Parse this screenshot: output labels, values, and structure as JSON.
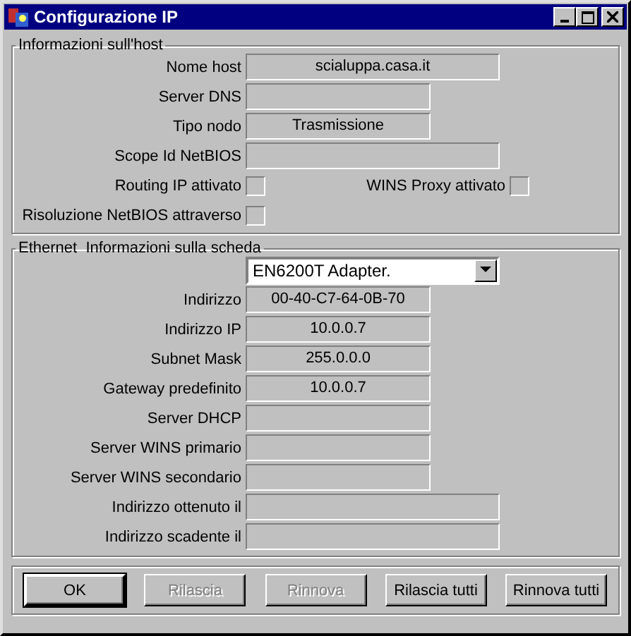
{
  "window": {
    "title": "Configurazione IP"
  },
  "host": {
    "title": "Informazioni sull'host",
    "rows": [
      {
        "kind": "field",
        "label": "Nome host",
        "value": "scialuppa.casa.it"
      },
      {
        "kind": "field",
        "label": "Server DNS",
        "value": ""
      },
      {
        "kind": "field",
        "label": "Tipo nodo",
        "value": "Trasmissione"
      },
      {
        "kind": "field",
        "label": "Scope Id NetBIOS",
        "value": ""
      },
      {
        "kind": "checks",
        "items": [
          {
            "label": "Routing IP attivato",
            "checked": false
          },
          {
            "label": "WINS Proxy attivato",
            "checked": false
          }
        ]
      },
      {
        "kind": "checks",
        "items": [
          {
            "label": "Risoluzione NetBIOS attraverso",
            "checked": false
          }
        ]
      }
    ]
  },
  "adapter": {
    "title": "Ethernet  Informazioni sulla scheda",
    "dropdown": {
      "value": "EN6200T Adapter."
    },
    "rows": [
      {
        "kind": "field",
        "label": "Indirizzo",
        "value": "00-40-C7-64-0B-70"
      },
      {
        "kind": "field",
        "label": "Indirizzo IP",
        "value": "10.0.0.7"
      },
      {
        "kind": "field",
        "label": "Subnet Mask",
        "value": "255.0.0.0"
      },
      {
        "kind": "field",
        "label": "Gateway predefinito",
        "value": "10.0.0.7"
      },
      {
        "kind": "field",
        "label": "Server DHCP",
        "value": ""
      },
      {
        "kind": "field",
        "label": "Server WINS primario",
        "value": ""
      },
      {
        "kind": "field",
        "label": "Server WINS secondario",
        "value": ""
      },
      {
        "kind": "field",
        "label": "Indirizzo ottenuto il",
        "value": ""
      },
      {
        "kind": "field",
        "label": "Indirizzo scadente il",
        "value": ""
      }
    ]
  },
  "buttons": [
    {
      "label": "OK",
      "disabled": false,
      "default": true
    },
    {
      "label": "Rilascia",
      "disabled": true,
      "default": false
    },
    {
      "label": "Rinnova",
      "disabled": true,
      "default": false
    },
    {
      "label": "Rilascia tutti",
      "disabled": false,
      "default": false
    },
    {
      "label": "Rinnova tutti",
      "disabled": false,
      "default": false
    }
  ]
}
